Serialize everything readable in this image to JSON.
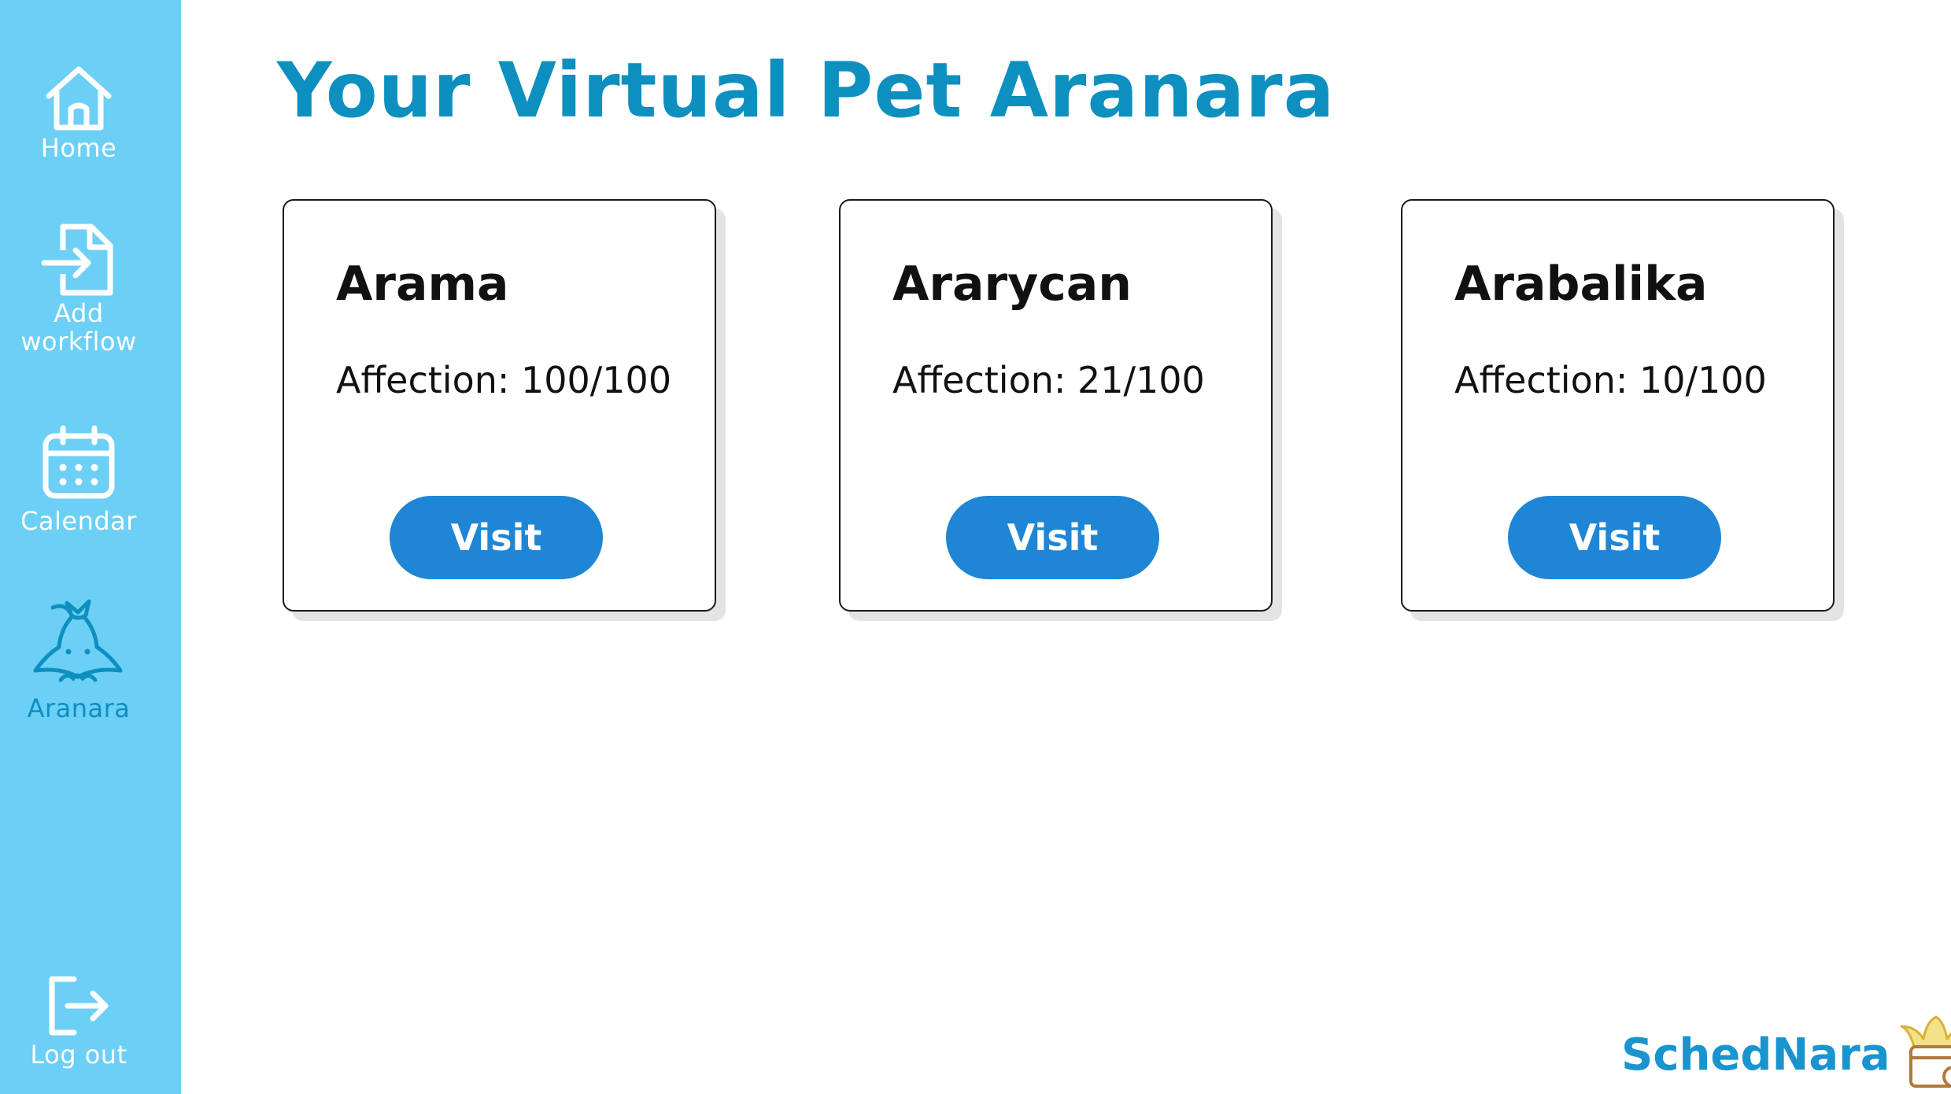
{
  "title": "Your Virtual Pet Aranara",
  "sidebar": {
    "items": [
      {
        "label": "Home",
        "icon": "home-icon"
      },
      {
        "label": "Add workflow",
        "icon": "file-import-icon"
      },
      {
        "label": "Calendar",
        "icon": "calendar-icon"
      },
      {
        "label": "Aranara",
        "icon": "aranara-icon",
        "active": true
      }
    ],
    "logout": {
      "label": "Log out",
      "icon": "logout-icon"
    }
  },
  "pets": [
    {
      "name": "Arama",
      "affection": "Affection: 100/100",
      "button": "Visit"
    },
    {
      "name": "Ararycan",
      "affection": "Affection: 21/100",
      "button": "Visit"
    },
    {
      "name": "Arabalika",
      "affection": "Affection: 10/100",
      "button": "Visit"
    }
  ],
  "brand": {
    "name": "SchedNara",
    "icon": "schednara-logo-icon"
  },
  "colors": {
    "sidebar": "#6ccff6",
    "active_nav": "#0d8fc0",
    "title": "#0d8fc0",
    "button": "#1f86d6",
    "brand": "#1a94cf"
  }
}
